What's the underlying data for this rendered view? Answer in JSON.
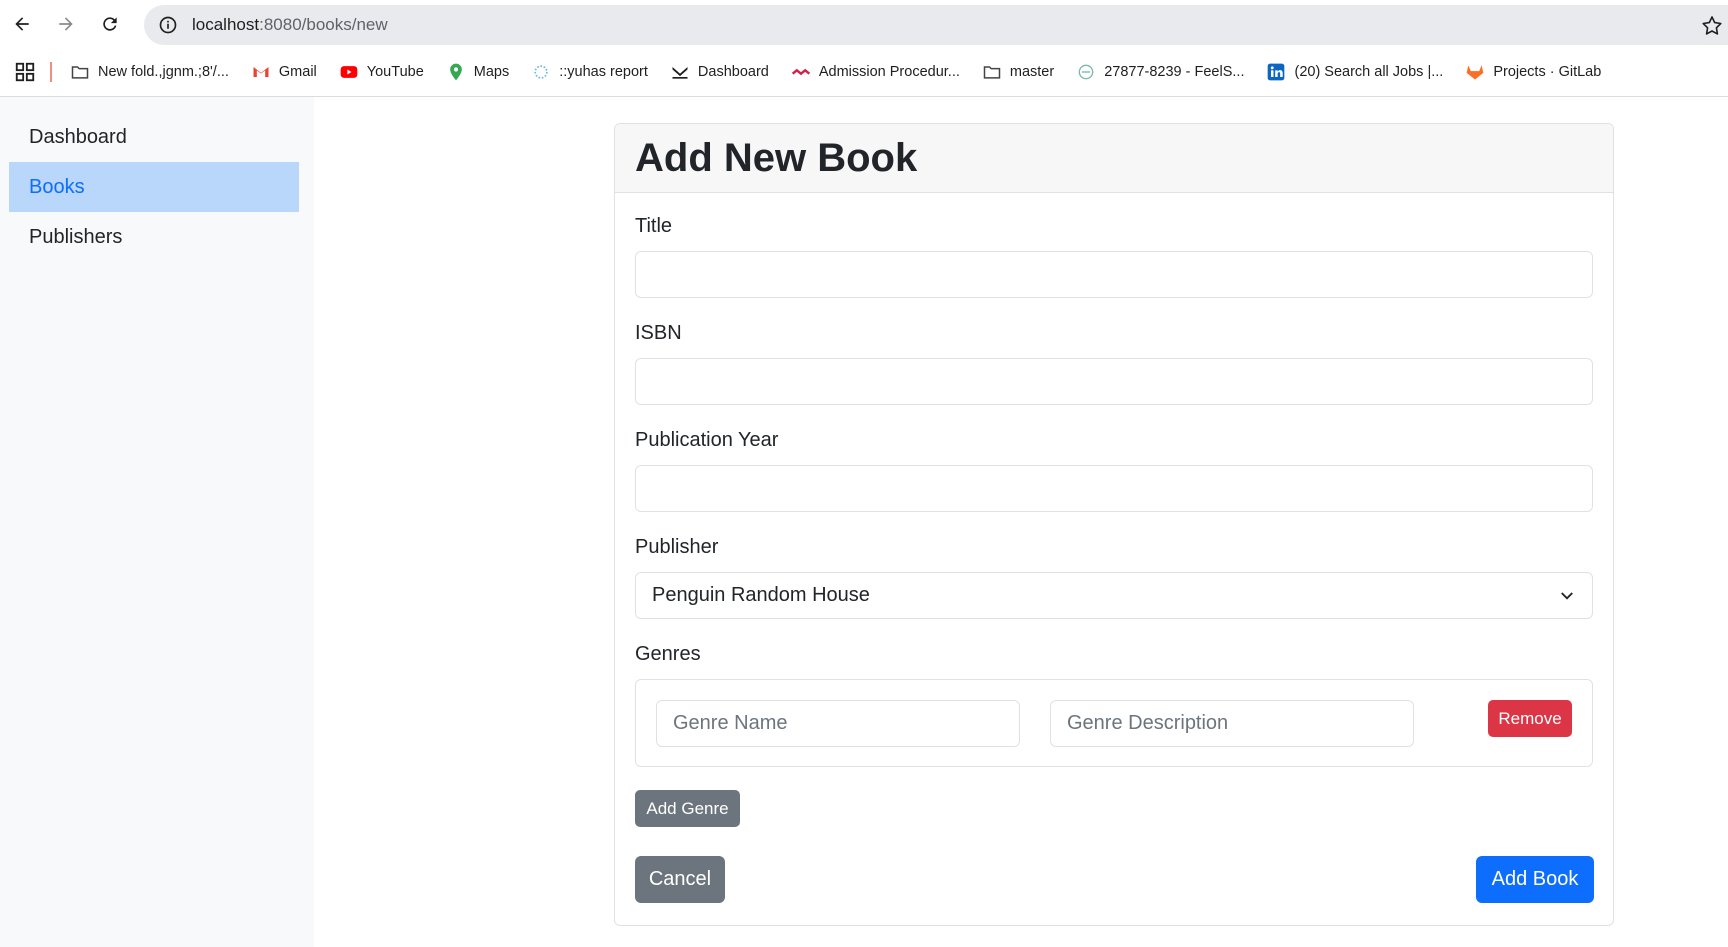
{
  "browser": {
    "url_host": "localhost",
    "url_rest": ":8080/books/new",
    "bookmarks": [
      {
        "label": "New fold.,jgnm.;8'/...",
        "icon": "folder-icon"
      },
      {
        "label": "Gmail",
        "icon": "gmail-icon"
      },
      {
        "label": "YouTube",
        "icon": "youtube-icon"
      },
      {
        "label": "Maps",
        "icon": "maps-icon"
      },
      {
        "label": "::yuhas report",
        "icon": "sun-icon"
      },
      {
        "label": "Dashboard",
        "icon": "check-icon"
      },
      {
        "label": "Admission Procedur...",
        "icon": "site-icon"
      },
      {
        "label": "master",
        "icon": "folder-icon"
      },
      {
        "label": "27877-8239 - FeelS...",
        "icon": "site-icon"
      },
      {
        "label": "(20) Search all Jobs |...",
        "icon": "linkedin-icon"
      },
      {
        "label": "Projects · GitLab",
        "icon": "gitlab-icon"
      }
    ]
  },
  "sidebar": {
    "items": [
      {
        "label": "Dashboard",
        "active": false
      },
      {
        "label": "Books",
        "active": true
      },
      {
        "label": "Publishers",
        "active": false
      }
    ]
  },
  "form": {
    "heading": "Add New Book",
    "title_label": "Title",
    "title_value": "",
    "isbn_label": "ISBN",
    "isbn_value": "",
    "year_label": "Publication Year",
    "year_value": "",
    "publisher_label": "Publisher",
    "publisher_selected": "Penguin Random House",
    "genres_label": "Genres",
    "genre_name_placeholder": "Genre Name",
    "genre_description_placeholder": "Genre Description",
    "remove_label": "Remove",
    "add_genre_label": "Add Genre",
    "cancel_label": "Cancel",
    "submit_label": "Add Book"
  },
  "colors": {
    "primary": "#0d6efd",
    "secondary": "#6c757d",
    "danger": "#dc3545",
    "sidebar_active_bg": "#b9d6fb"
  }
}
